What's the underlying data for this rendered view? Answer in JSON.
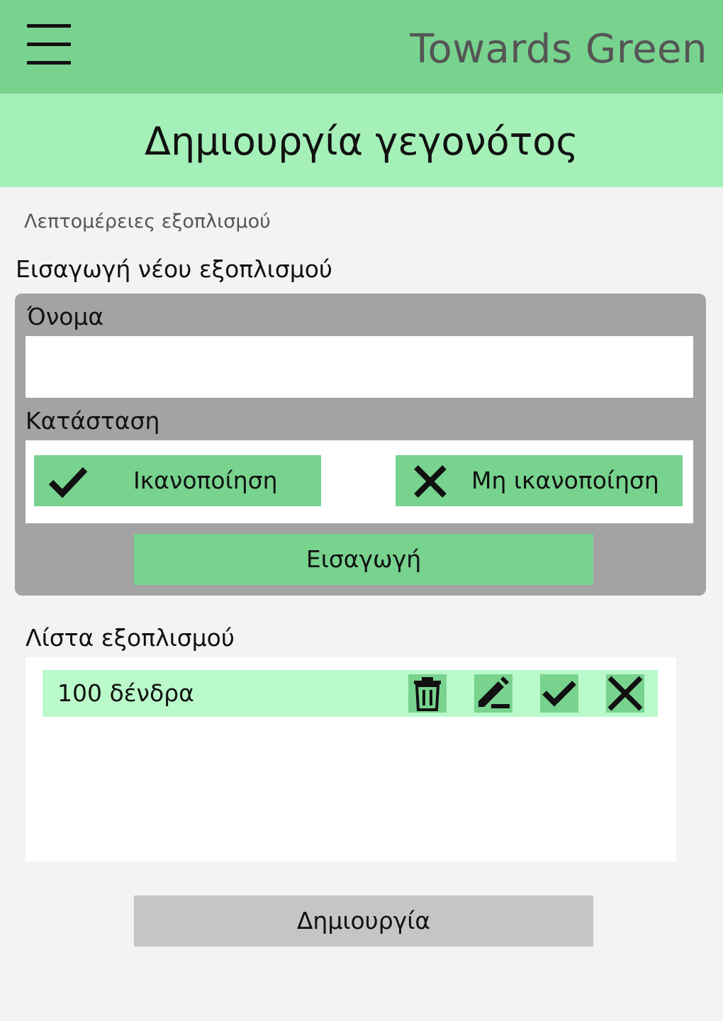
{
  "header": {
    "app_title": "Towards Green",
    "menu_icon": "hamburger-menu-icon",
    "background_color": "#78d38f"
  },
  "page": {
    "title": "Δημιουργία γεγονότος",
    "title_band_color": "#a5f0b8"
  },
  "breadcrumb": "Λεπτομέρειες εξοπλισμού",
  "new_equipment": {
    "section_label": "Εισαγωγή νέου εξοπλισμού",
    "name_label": "Όνομα",
    "name_value": "",
    "status_label": "Κατάσταση",
    "status_options": [
      {
        "label": "Ικανοποίηση",
        "icon": "check-icon"
      },
      {
        "label": "Μη ικανοποίηση",
        "icon": "close-icon"
      }
    ],
    "insert_button": "Εισαγωγή"
  },
  "equipment_list": {
    "label": "Λίστα εξοπλισμού",
    "items": [
      {
        "name": "100 δένδρα",
        "actions": [
          "trash-icon",
          "edit-icon",
          "check-icon",
          "close-icon"
        ]
      }
    ]
  },
  "create_button": "Δημιουργία",
  "colors": {
    "accent_green": "#78d38f",
    "row_green": "#baf9c9",
    "card_gray": "#a3a3a3",
    "disabled_gray": "#c5c5c5"
  }
}
